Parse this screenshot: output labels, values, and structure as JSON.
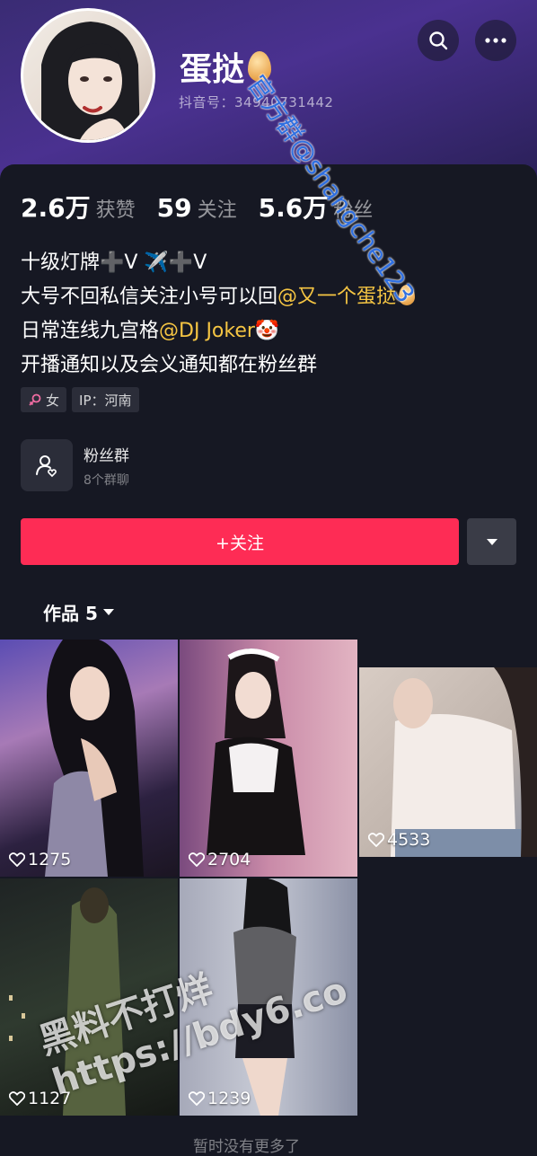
{
  "profile": {
    "name": "蛋挞",
    "douyin_id": "抖音号：34940731442",
    "stats": [
      {
        "value": "2.6万",
        "label": "获赞"
      },
      {
        "value": "59",
        "label": "关注"
      },
      {
        "value": "5.6万",
        "label": "粉丝"
      }
    ],
    "bio": {
      "line1": "十级灯牌➕V ✈️➕V",
      "line2_prefix": "大号不回私信关注小号可以回",
      "line2_mention": "@又一个蛋挞",
      "line3_prefix": "日常连线九宫格",
      "line3_mention": "@DJ Joker",
      "line3_emoji": "🤡",
      "line4": "开播通知以及会义通知都在粉丝群"
    },
    "tags": {
      "gender": "女",
      "ip": "IP：河南"
    }
  },
  "fan_group": {
    "title": "粉丝群",
    "subtitle": "8个群聊"
  },
  "actions": {
    "follow_label": "+关注"
  },
  "works": {
    "tab_label": "作品 5",
    "items": [
      {
        "likes": "1275"
      },
      {
        "likes": "2704"
      },
      {
        "likes": "4533"
      },
      {
        "likes": "1127"
      },
      {
        "likes": "1239"
      }
    ]
  },
  "footer": {
    "text": "暂时没有更多了"
  },
  "watermarks": {
    "diagonal": "官方群@shangche123",
    "bottom_line1": "黑料不打烊",
    "bottom_line2": "https://bdy6.co"
  },
  "colors": {
    "accent": "#fe2c55",
    "mention": "#f5c543",
    "background": "#161823"
  }
}
